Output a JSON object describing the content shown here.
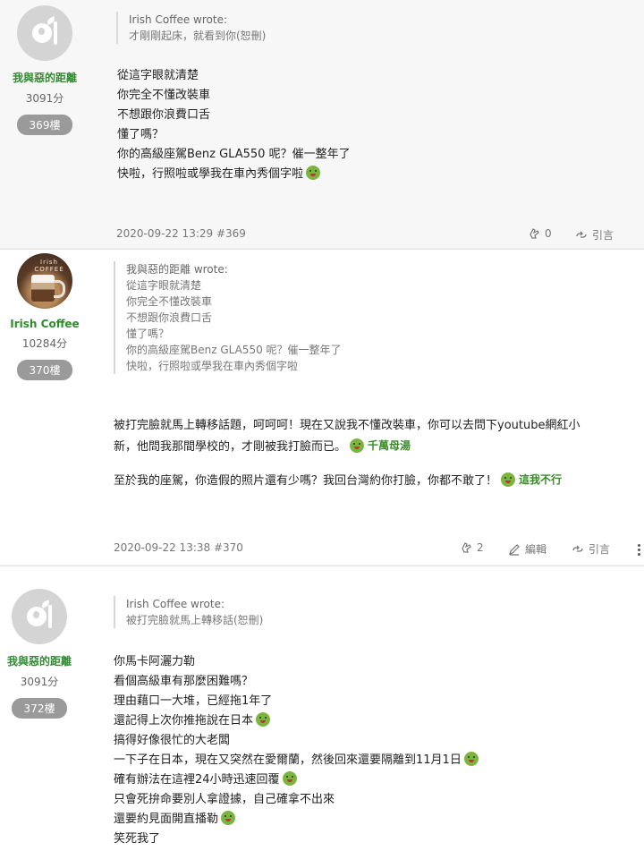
{
  "posts": [
    {
      "author": "我與惡的距離",
      "points": "3091分",
      "floor": "369樓",
      "avatar_icon": "coffee-fork-icon",
      "quote": {
        "author": "Irish Coffee wrote:",
        "lines": [
          "才剛剛起床，就看到你(恕刪)"
        ]
      },
      "body_lines": [
        "從這字眼就清楚",
        "你完全不懂改裝車",
        "不想跟你浪費口舌",
        "懂了嗎？",
        "你的高級座駕Benz GLA550 呢？催一整年了",
        "快啦，行照啦或學我在車內秀個字啦"
      ],
      "timestamp": "2020-09-22 13:29 #369",
      "likes": "0",
      "quote_label": "引言"
    },
    {
      "author": "Irish Coffee",
      "points": "10284分",
      "floor": "370樓",
      "avatar_text": "Irish COFFEE",
      "quote": {
        "author": "我與惡的距離 wrote:",
        "lines": [
          "從這字眼就清楚",
          "你完全不懂改裝車",
          "不想跟你浪費口舌",
          "懂了嗎？",
          "你的高級座駕Benz GLA550 呢？催一整年了",
          "快啦，行照啦或學我在車內秀個字啦"
        ]
      },
      "body_p1_l1": "被打完臉就馬上轉移話題，呵呵呵！現在又說我不懂改裝車，你可以去問下youtube網紅小",
      "body_p1_l2": "新，他問我那間學校的，才剛被我打臉而已。",
      "sticker1": "千萬母湯",
      "body_p2": "至於我的座駕，你造假的照片還有少嗎？我回台灣約你打臉，你都不敢了！",
      "sticker2": "這我不行",
      "timestamp": "2020-09-22 13:38 #370",
      "likes": "2",
      "edit_label": "編輯",
      "quote_label": "引言"
    },
    {
      "author": "我與惡的距離",
      "points": "3091分",
      "floor": "372樓",
      "quote": {
        "author": "Irish Coffee wrote:",
        "lines": [
          "被打完臉就馬上轉移話(恕刪)"
        ]
      },
      "body_lines": [
        "你馬卡阿灑力勒",
        "看個高級車有那麼困難嗎？",
        "理由藉口一大堆，已經拖1年了",
        "還記得上次你推拖說在日本",
        "搞得好像很忙的大老闆",
        "一下子在日本，現在又突然在愛爾蘭，然後回來還要隔離到11月1日",
        "確有辦法在這裡24小時迅速回覆",
        "只會死拚命要別人拿證據，自己確拿不出來",
        "還要約見面開直播勒",
        "笑死我了"
      ]
    }
  ]
}
